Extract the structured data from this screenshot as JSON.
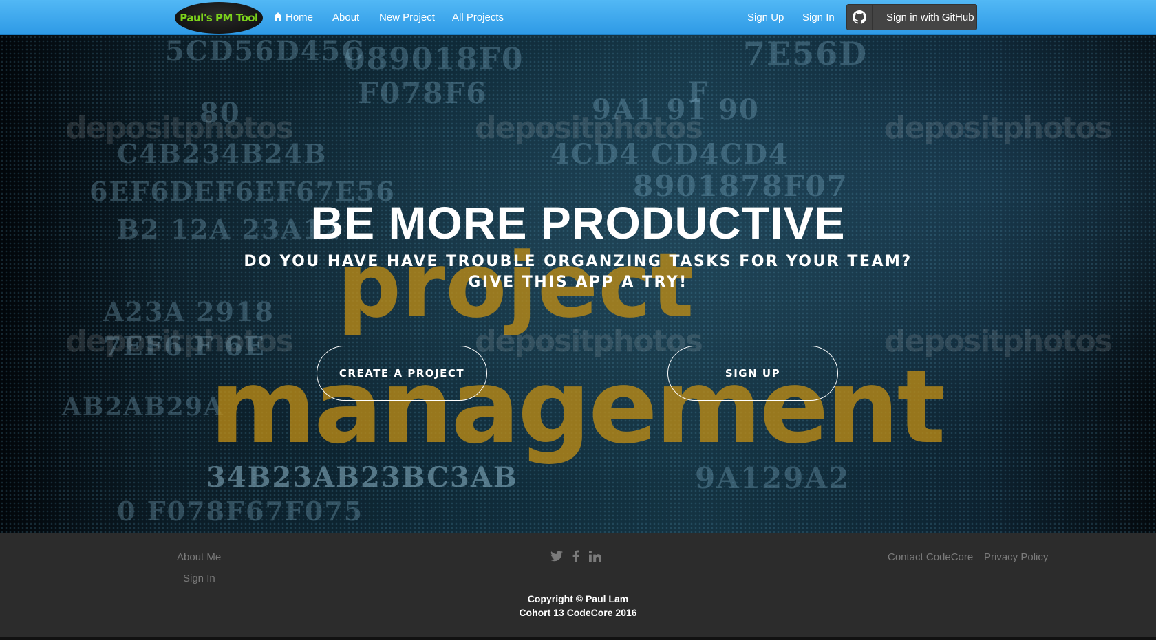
{
  "navbar": {
    "brand": "Paul's PM Tool",
    "links": [
      {
        "label": "Home",
        "icon": "home-icon"
      },
      {
        "label": "About"
      },
      {
        "label": "New Project"
      },
      {
        "label": "All Projects"
      }
    ],
    "right_links": [
      {
        "label": "Sign Up"
      },
      {
        "label": "Sign In"
      }
    ],
    "github_button": {
      "label": "Sign in with GitHub",
      "icon": "github-icon"
    }
  },
  "hero": {
    "title": "BE MORE PRODUCTIVE",
    "subtitle_line1": "DO YOU HAVE HAVE TROUBLE ORGANZING TASKS FOR YOUR TEAM?",
    "subtitle_line2": "GIVE THIS APP A TRY!",
    "buttons": [
      {
        "label": "CREATE A PROJECT"
      },
      {
        "label": "SIGN UP"
      }
    ],
    "background_words": {
      "word1": "project",
      "word2": "management",
      "watermark": "depositphotos"
    }
  },
  "footer": {
    "left_links": [
      {
        "label": "About Me"
      },
      {
        "label": "Sign In"
      }
    ],
    "social_icons": [
      "twitter-icon",
      "facebook-icon",
      "linkedin-icon"
    ],
    "right_links": [
      {
        "label": "Contact CodeCore"
      },
      {
        "label": "Privacy Policy"
      }
    ],
    "copyright_line1": "Copyright © Paul Lam",
    "copyright_line2": "Cohort 13 CodeCore 2016"
  },
  "colors": {
    "navbar": "#3aa8ee",
    "footer": "#2c2c2c",
    "brand_text": "#7cd21b",
    "github_button": "#444444"
  }
}
